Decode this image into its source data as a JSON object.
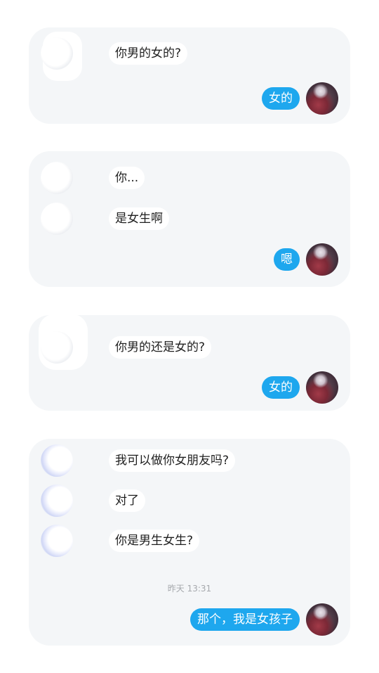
{
  "conversations": [
    {
      "messages": [
        {
          "from": "other",
          "text": "你男的女的?"
        },
        {
          "from": "me",
          "text": "女的"
        }
      ]
    },
    {
      "messages": [
        {
          "from": "other",
          "text": "你..."
        },
        {
          "from": "other",
          "text": "是女生啊"
        },
        {
          "from": "me",
          "text": "嗯"
        }
      ]
    },
    {
      "messages": [
        {
          "from": "other",
          "text": "你男的还是女的?"
        },
        {
          "from": "me",
          "text": "女的"
        }
      ]
    },
    {
      "messages": [
        {
          "from": "other",
          "text": "我可以做你女朋友吗?"
        },
        {
          "from": "other",
          "text": "对了"
        },
        {
          "from": "other",
          "text": "你是男生女生?"
        },
        {
          "from": "me",
          "text": "那个，我是女孩子"
        }
      ],
      "timestamp": "昨天 13:31"
    }
  ]
}
